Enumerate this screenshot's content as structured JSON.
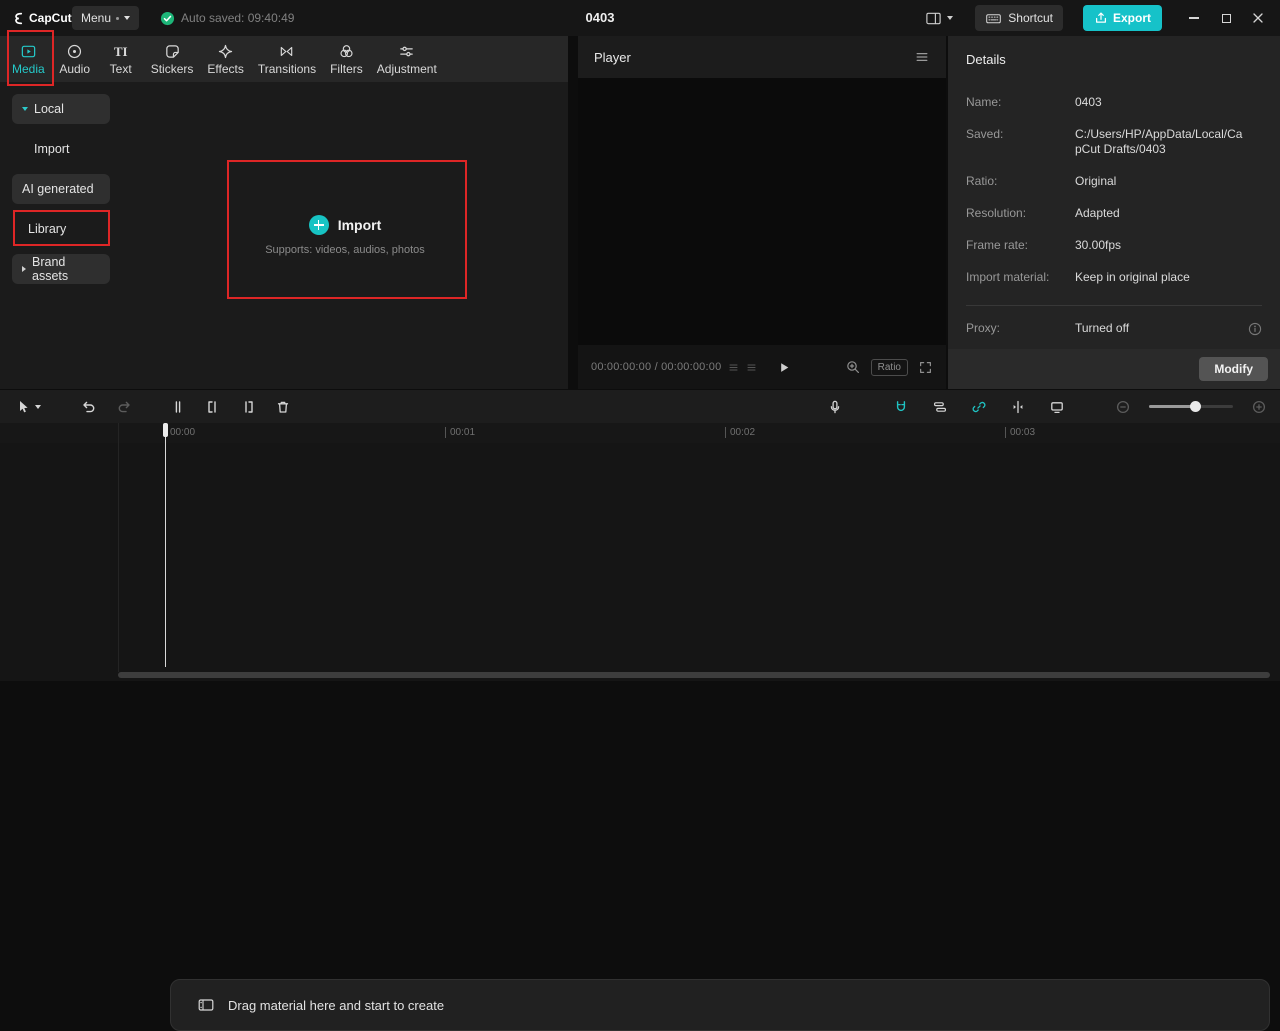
{
  "titlebar": {
    "app_name": "CapCut",
    "menu_label": "Menu",
    "autosave_text": "Auto saved: 09:40:49",
    "document_title": "0403",
    "shortcut_label": "Shortcut",
    "export_label": "Export"
  },
  "media_panel": {
    "tabs": [
      "Media",
      "Audio",
      "Text",
      "Stickers",
      "Effects",
      "Transitions",
      "Filters",
      "Adjustment"
    ],
    "text_tab_glyph": "TI",
    "sidebar": {
      "local": "Local",
      "import": "Import",
      "ai_generated": "AI generated",
      "library": "Library",
      "brand_assets": "Brand assets"
    },
    "import_area": {
      "title": "Import",
      "subtitle": "Supports: videos, audios, photos"
    }
  },
  "player": {
    "title": "Player",
    "timecode": "00:00:00:00 / 00:00:00:00",
    "ratio_label": "Ratio"
  },
  "details": {
    "title": "Details",
    "rows": [
      {
        "label": "Name:",
        "value": "0403"
      },
      {
        "label": "Saved:",
        "value": "C:/Users/HP/AppData/Local/CapCut Drafts/0403"
      },
      {
        "label": "Ratio:",
        "value": "Original"
      },
      {
        "label": "Resolution:",
        "value": "Adapted"
      },
      {
        "label": "Frame rate:",
        "value": "30.00fps"
      },
      {
        "label": "Import material:",
        "value": "Keep in original place"
      },
      {
        "label": "Proxy:",
        "value": "Turned off"
      }
    ],
    "modify_label": "Modify"
  },
  "timeline": {
    "ruler": [
      "00:00",
      "00:01",
      "00:02",
      "00:03"
    ],
    "placeholder": "Drag material here and start to create"
  },
  "colors": {
    "accent": "#1ec8c8",
    "export_button": "#16c2c9",
    "annotation": "#de2626",
    "autosave_check": "#1db578"
  }
}
